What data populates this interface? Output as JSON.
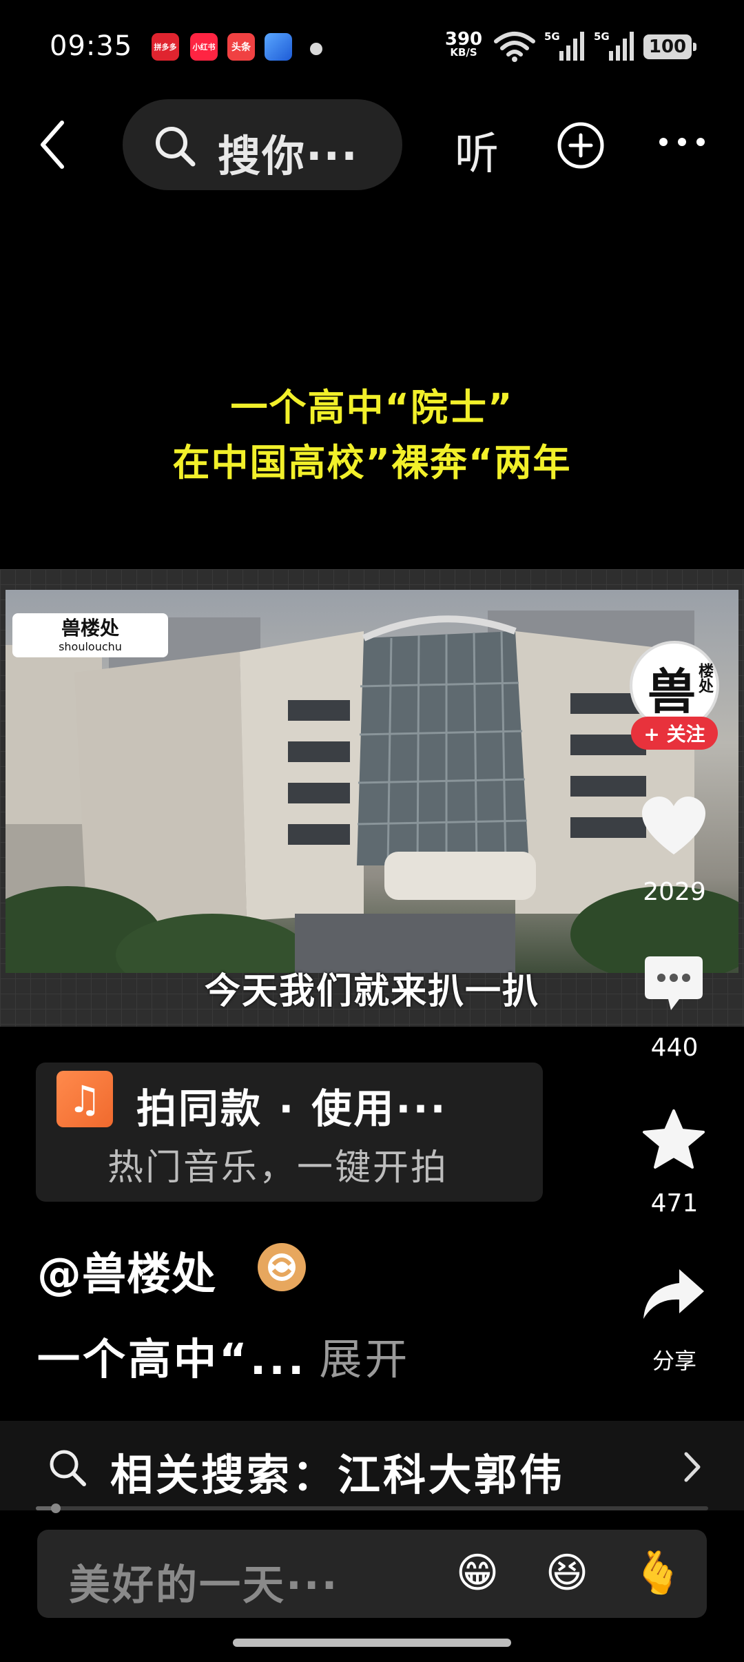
{
  "status_bar": {
    "time": "09:35",
    "app_icons": [
      "拼多多",
      "小红书",
      "头条",
      ""
    ],
    "net_speed": "390",
    "net_unit": "KB/S",
    "signal_1": "5G",
    "signal_2": "5G",
    "battery": "100"
  },
  "nav": {
    "search_placeholder": "搜你···",
    "listen_label": "听"
  },
  "video": {
    "caption_line1": "一个高中“院士”",
    "caption_line2": "在中国高校”裸奔“两年",
    "watermark_cn": "兽楼处",
    "watermark_en": "shoulouchu",
    "subtitle": "今天我们就来扒一扒"
  },
  "author_avatar": {
    "big_char": "兽",
    "small_text": "楼处"
  },
  "actions": {
    "follow_label": "+ 关注",
    "like_count": "2029",
    "comment_count": "440",
    "favorite_count": "471",
    "share_label": "分享"
  },
  "music_card": {
    "title": "拍同款 · 使用···",
    "subtitle": "热门音乐，一键开拍"
  },
  "post": {
    "author": "@兽楼处",
    "description": "一个高中“...",
    "expand_label": "展开"
  },
  "related_search": {
    "text": "相关搜索：江科大郭伟"
  },
  "progress": {
    "fraction": 0.03
  },
  "comment_bar": {
    "placeholder": "美好的一天···",
    "emojis": [
      "😁",
      "😆",
      "🫰"
    ]
  },
  "colors": {
    "background": "#000000",
    "caption_yellow": "#f2f02a",
    "follow_red": "#e8323c",
    "verified_gold": "#e7a75e"
  }
}
